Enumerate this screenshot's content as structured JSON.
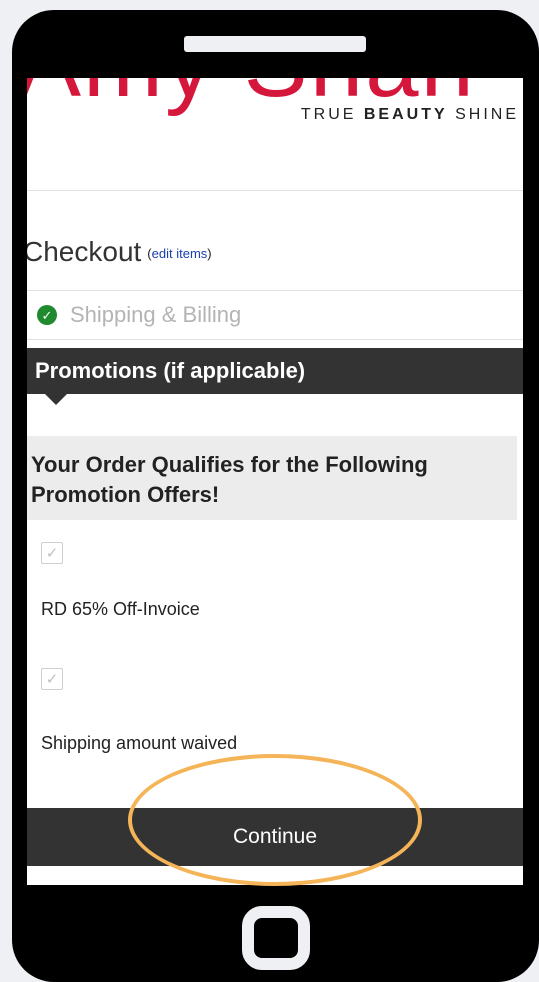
{
  "logo": {
    "brand_text": "Amy Shah",
    "tagline_regular_1": "TRUE ",
    "tagline_bold": "BEAUTY",
    "tagline_regular_2": " SHINE"
  },
  "checkout": {
    "title": "Checkout",
    "edit_open": "(",
    "edit_link": "edit items",
    "edit_close": ")"
  },
  "steps": {
    "shipping_billing": "Shipping & Billing",
    "promotions_header": "Promotions (if applicable)"
  },
  "promotions": {
    "qualify_message": "Your Order Qualifies for the Following Promotion Offers!",
    "offers": [
      {
        "label": "RD 65% Off-Invoice",
        "checked": true
      },
      {
        "label": "Shipping amount waived",
        "checked": true
      }
    ]
  },
  "actions": {
    "continue_label": "Continue"
  },
  "colors": {
    "brand_red": "#d6173c",
    "dark_bar": "#333333",
    "success_green": "#1f8a2e",
    "highlight_orange": "#f4b457",
    "link_blue": "#1a3fb0"
  },
  "icons": {
    "step_done": "check-circle-icon",
    "offer_checkbox": "checkbox-checked-icon"
  }
}
